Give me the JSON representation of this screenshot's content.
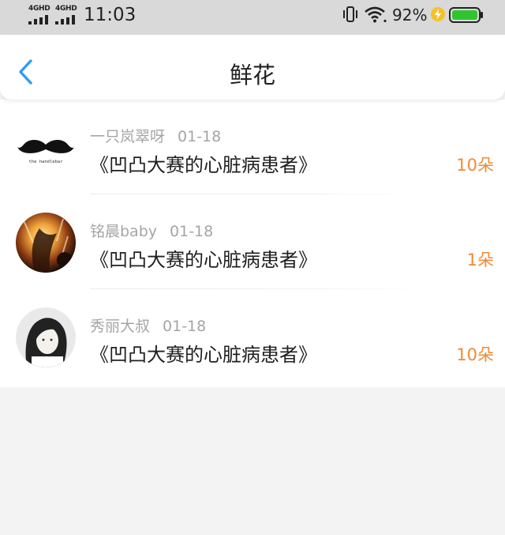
{
  "status_bar": {
    "network_1": "4GHD",
    "network_2": "4GHD",
    "time": "11:03",
    "battery": "92%"
  },
  "header": {
    "title": "鲜花",
    "back_icon": "chevron-left-icon"
  },
  "colors": {
    "accent_blue": "#2f9cf3",
    "count_orange": "#f28a32",
    "battery_green": "#2ec52e",
    "charge_yellow": "#f6c026"
  },
  "items": [
    {
      "username": "一只岚翠呀",
      "date": "01-18",
      "title": "《凹凸大赛的心脏病患者》",
      "count": "10朵",
      "avatar_text": "the handlebar"
    },
    {
      "username": "铭晨baby",
      "date": "01-18",
      "title": "《凹凸大赛的心脏病患者》",
      "count": "1朵"
    },
    {
      "username": "秀丽大叔",
      "date": "01-18",
      "title": "《凹凸大赛的心脏病患者》",
      "count": "10朵"
    }
  ]
}
